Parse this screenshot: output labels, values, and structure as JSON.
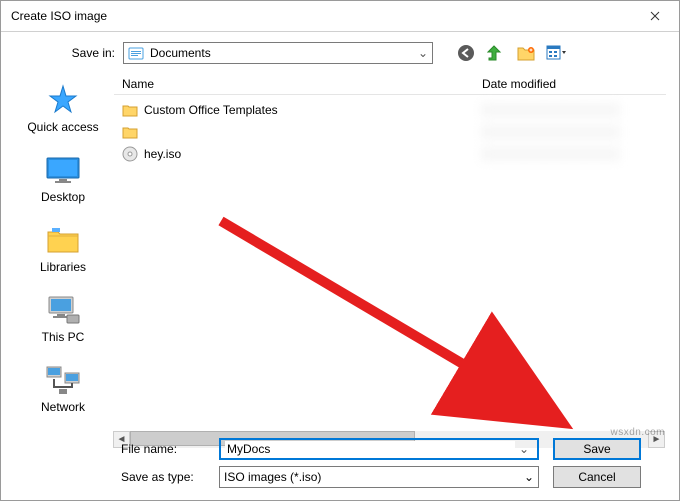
{
  "title": "Create ISO image",
  "save_in_label": "Save in:",
  "save_in_value": "Documents",
  "columns": {
    "name": "Name",
    "date": "Date modified"
  },
  "sidebar": [
    {
      "label": "Quick access"
    },
    {
      "label": "Desktop"
    },
    {
      "label": "Libraries"
    },
    {
      "label": "This PC"
    },
    {
      "label": "Network"
    }
  ],
  "files": [
    {
      "name": "Custom Office Templates",
      "type": "folder"
    },
    {
      "name": "",
      "type": "folder"
    },
    {
      "name": "hey.iso",
      "type": "iso"
    }
  ],
  "file_name_label": "File name:",
  "file_name_value": "MyDocs",
  "save_type_label": "Save as type:",
  "save_type_value": "ISO images (*.iso)",
  "buttons": {
    "save": "Save",
    "cancel": "Cancel"
  },
  "watermark": "wsxdn.com"
}
